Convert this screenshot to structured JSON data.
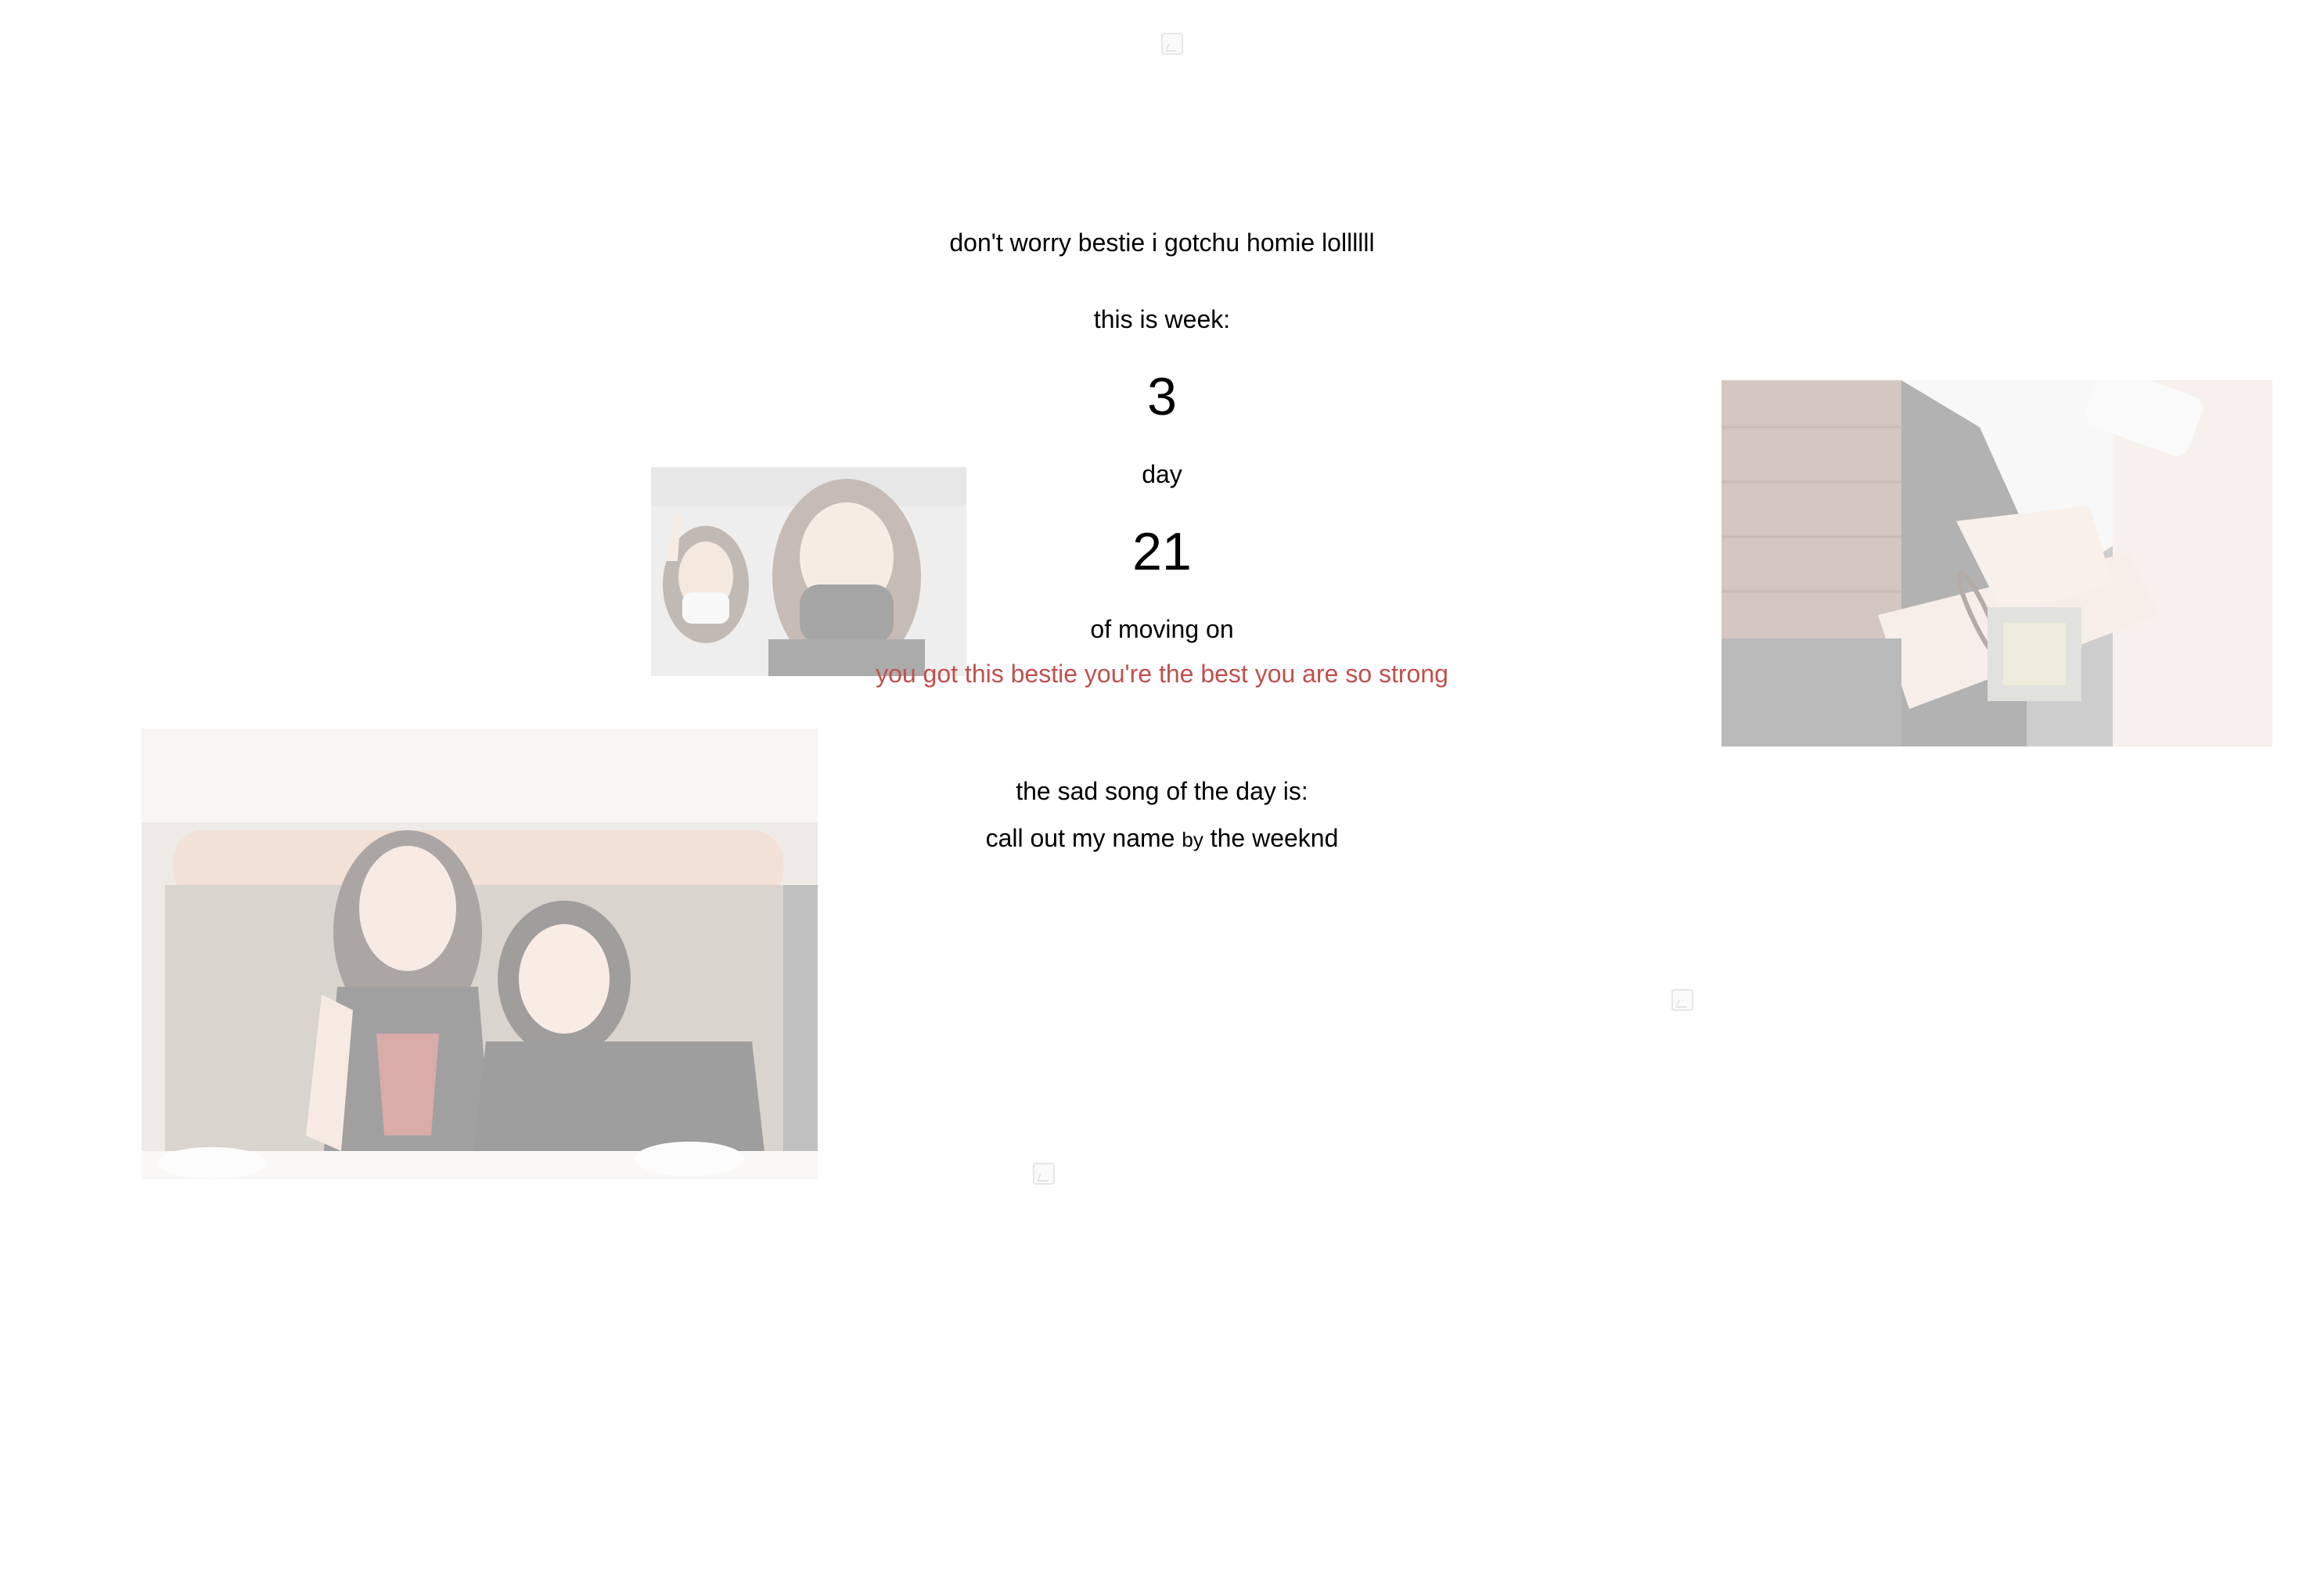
{
  "header": {
    "logo_alt": ""
  },
  "message": {
    "line1": "don't worry bestie i gotchu homie lollllll",
    "week_label": "this is week:",
    "week_number": "3",
    "day_label": "day",
    "day_number": "21",
    "moving_on_label": "of moving on",
    "encouragement": "you got this bestie you're the best you are so strong"
  },
  "song": {
    "label": "the sad song of the day is:",
    "title": "call out my name",
    "by": "by",
    "artist": "the weeknd"
  },
  "colors": {
    "accent": "#c0504d",
    "text": "#000000",
    "background": "#ffffff"
  },
  "images": [
    {
      "name": "selfie-photo"
    },
    {
      "name": "hands-photo"
    },
    {
      "name": "restaurant-photo"
    }
  ]
}
